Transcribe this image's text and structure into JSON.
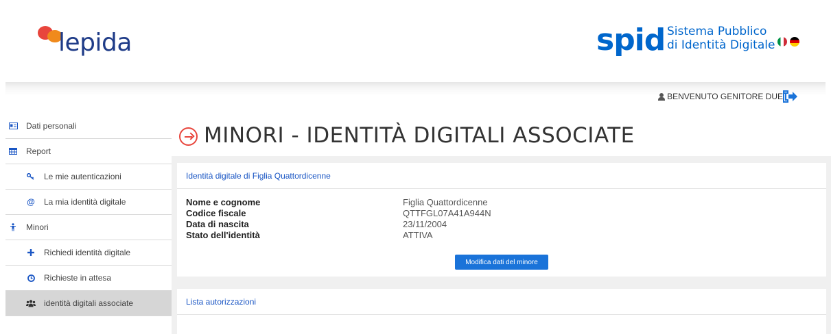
{
  "header": {
    "lepida_logo": "lepida",
    "spid_logo": "spid",
    "spid_line1": "Sistema Pubblico",
    "spid_line2": "di Identità Digitale"
  },
  "topbar": {
    "welcome": "BENVENUTO GENITORE DUE",
    "icons": [
      "user-icon",
      "logout-icon"
    ]
  },
  "sidebar": {
    "items": [
      {
        "label": "Dati personali",
        "icon": "id-card-icon"
      },
      {
        "label": "Report",
        "icon": "table-icon"
      },
      {
        "label": "Le mie autenticazioni",
        "icon": "key-icon"
      },
      {
        "label": "La mia identità digitale",
        "icon": "at-icon"
      },
      {
        "label": "Minori",
        "icon": "child-icon"
      },
      {
        "label": "Richiedi identità digitale",
        "icon": "plus-icon"
      },
      {
        "label": "Richieste in attesa",
        "icon": "clock-icon"
      },
      {
        "label": "identità digitali associate",
        "icon": "users-icon"
      }
    ]
  },
  "main": {
    "title": "MINORI - IDENTITÀ DIGITALI ASSOCIATE",
    "card1": {
      "heading": "Identità digitale di Figlia Quattordicenne",
      "rows": [
        {
          "label": "Nome e cognome",
          "value": "Figlia Quattordicenne"
        },
        {
          "label": "Codice fiscale",
          "value": "QTTFGL07A41A944N"
        },
        {
          "label": "Data di nascita",
          "value": "23/11/2004"
        },
        {
          "label": "Stato dell'identità",
          "value": "ATTIVA"
        }
      ],
      "button": "Modifica dati del minore"
    },
    "card2": {
      "heading": "Lista autorizzazioni"
    }
  },
  "colors": {
    "accent_blue": "#1a73d9",
    "link_blue": "#1a56c4",
    "spid_blue": "#0066cc",
    "accent_red": "#e8453c"
  }
}
